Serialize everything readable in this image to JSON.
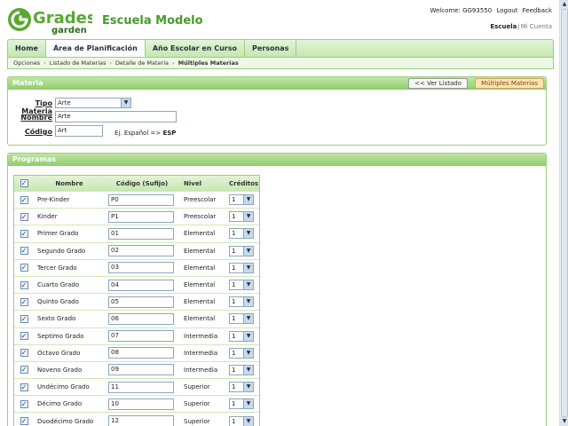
{
  "header": {
    "logo_top": "Grades",
    "logo_bottom": "garden",
    "school": "Escuela Modelo",
    "welcome": "Welcome: GG93550",
    "logout": "Logout",
    "feedback": "Feedback",
    "escuela_link": "Escuela",
    "cuenta_link": "Mi Cuenta"
  },
  "nav": {
    "tabs": [
      "Home",
      "Área de Planificación",
      "Año Escolar en Curso",
      "Personas"
    ],
    "active": "Área de Planificación"
  },
  "breadcrumb": [
    "Opciones",
    "Listado de Materias",
    "Detalle de Materia",
    "Múltiples Materias"
  ],
  "materia": {
    "title": "Materia",
    "btn_listado": "<< Ver Listado",
    "btn_multiples": "Múltiples Materias",
    "tipo_label": "Tipo Materia",
    "tipo_value": "Arte",
    "nombre_label": "Nombre",
    "nombre_value": "Arte",
    "codigo_label": "Código",
    "codigo_value": "Art",
    "hint_prefix": "Ej. Español =>",
    "hint_code": "ESP"
  },
  "programas": {
    "title": "Programas",
    "columns": [
      "Nombre",
      "Código (Sufijo)",
      "Nivel",
      "Créditos"
    ],
    "rows": [
      {
        "name": "Pre-Kinder",
        "code": "P0",
        "level": "Preescolar",
        "credits": "1"
      },
      {
        "name": "Kinder",
        "code": "P1",
        "level": "Preescolar",
        "credits": "1"
      },
      {
        "name": "Primer Grado",
        "code": "01",
        "level": "Elemental",
        "credits": "1"
      },
      {
        "name": "Segundo Grado",
        "code": "02",
        "level": "Elemental",
        "credits": "1"
      },
      {
        "name": "Tercer Grado",
        "code": "03",
        "level": "Elemental",
        "credits": "1"
      },
      {
        "name": "Cuarto Grado",
        "code": "04",
        "level": "Elemental",
        "credits": "1"
      },
      {
        "name": "Quinto Grado",
        "code": "05",
        "level": "Elemental",
        "credits": "1"
      },
      {
        "name": "Sexto Grado",
        "code": "06",
        "level": "Elemental",
        "credits": "1"
      },
      {
        "name": "Septimo Grado",
        "code": "07",
        "level": "Intermedia",
        "credits": "1"
      },
      {
        "name": "Octavo Grado",
        "code": "08",
        "level": "Intermedia",
        "credits": "1"
      },
      {
        "name": "Noveno Grado",
        "code": "09",
        "level": "Intermedia",
        "credits": "1"
      },
      {
        "name": "Undécimo Grado",
        "code": "11",
        "level": "Superior",
        "credits": "1"
      },
      {
        "name": "Décimo Grado",
        "code": "10",
        "level": "Superior",
        "credits": "1"
      },
      {
        "name": "Duodécimo Grado",
        "code": "12",
        "level": "Superior",
        "credits": "1"
      }
    ]
  },
  "colors": {
    "brand_green": "#4a9a2a",
    "panel_header": "#8fcd6a",
    "accent_button": "#fbe3b5"
  }
}
